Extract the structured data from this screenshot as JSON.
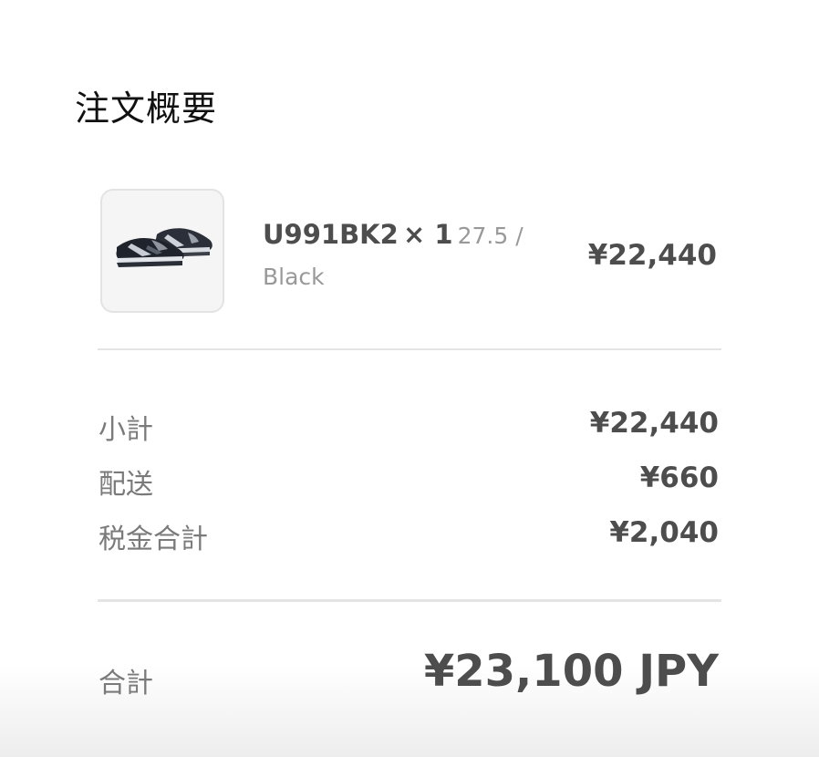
{
  "order_summary": {
    "title": "注文概要",
    "item": {
      "image_icon": "sneaker-product-image",
      "name": "U991BK2",
      "quantity": "× 1",
      "variant_line1": "27.5 /",
      "variant_line2": "Black",
      "price": "¥22,440"
    },
    "rows": [
      {
        "label": "小計",
        "value": "¥22,440"
      },
      {
        "label": "配送",
        "value": "¥660"
      },
      {
        "label": "税金合計",
        "value": "¥2,040"
      }
    ],
    "total": {
      "label": "合計",
      "value": "¥23,100 JPY"
    }
  },
  "colors": {
    "text_dark": "#4d4d4d",
    "text_muted": "#7a7a7a",
    "text_light": "#999999",
    "divider": "#e4e4e4"
  }
}
